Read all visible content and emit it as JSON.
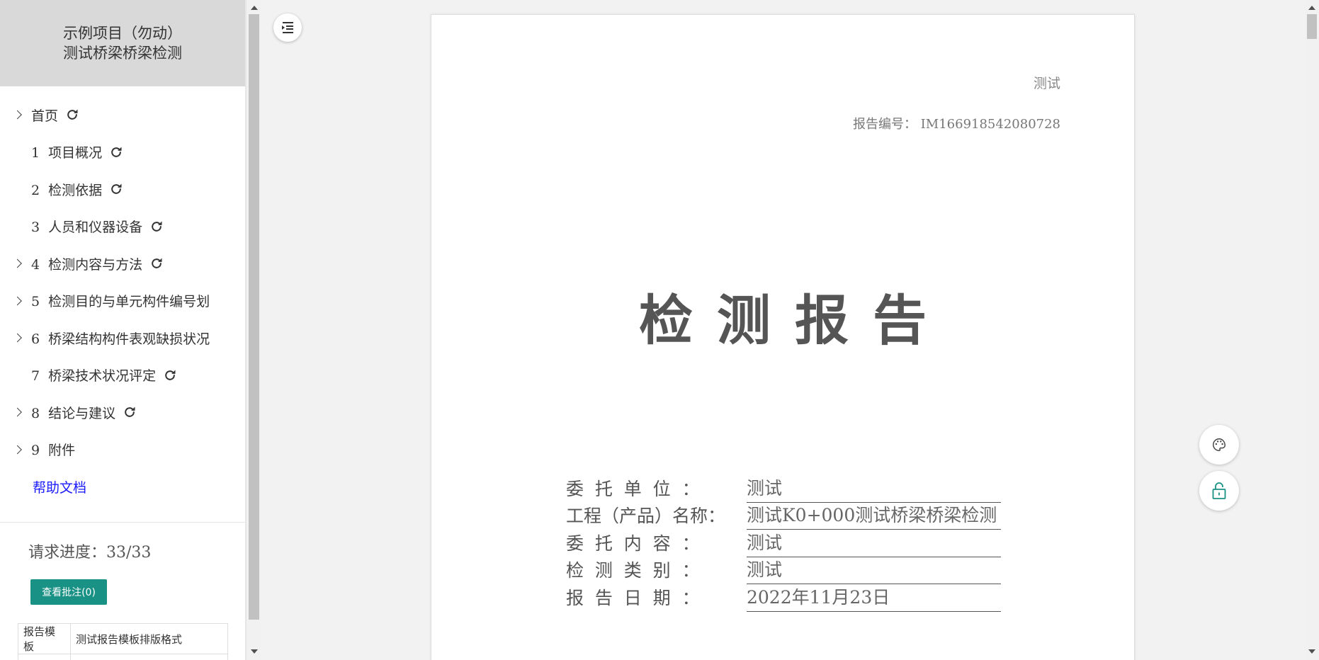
{
  "sidebar": {
    "title_line1": "示例项目（勿动）",
    "title_line2": "测试桥梁桥梁检测",
    "items": [
      {
        "label": "首页",
        "expandable": true,
        "refresh": true
      },
      {
        "label": "1  项目概况",
        "expandable": false,
        "refresh": true
      },
      {
        "label": "2  检测依据",
        "expandable": false,
        "refresh": true
      },
      {
        "label": "3  人员和仪器设备",
        "expandable": false,
        "refresh": true
      },
      {
        "label": "4  检测内容与方法",
        "expandable": true,
        "refresh": true
      },
      {
        "label": "5  检测目的与单元构件编号划",
        "expandable": true,
        "refresh": false
      },
      {
        "label": "6  桥梁结构构件表观缺损状况",
        "expandable": true,
        "refresh": false
      },
      {
        "label": "7  桥梁技术状况评定",
        "expandable": false,
        "refresh": true
      },
      {
        "label": "8  结论与建议",
        "expandable": true,
        "refresh": true
      },
      {
        "label": "9  附件",
        "expandable": true,
        "refresh": false
      }
    ],
    "help_label": "帮助文档",
    "progress_label": "请求进度：33/33",
    "annotation_button": "查看批注(0)",
    "template_label": "报告模板",
    "template_value": "测试报告模板排版格式"
  },
  "document": {
    "org": "测试",
    "report_number": "报告编号： IM166918542080728",
    "title": "检测报告",
    "fields": [
      {
        "label": "委  托  单  位  ：",
        "value": "测试"
      },
      {
        "label": "工程（产品）名称：",
        "value": "测试K0+000测试桥梁桥梁检测"
      },
      {
        "label": "委  托  内  容  ：",
        "value": "测试"
      },
      {
        "label": "检  测  类  别  ：",
        "value": "测试"
      },
      {
        "label": "报  告  日  期  ：",
        "value": "2022年11月23日"
      }
    ]
  },
  "colors": {
    "accent": "#1a9185",
    "link": "#1a1aff",
    "sidebar_header": "#d9d9d9",
    "lock_icon": "#1a9185"
  },
  "icons": {
    "toc": "outline-list-icon",
    "theme": "palette-icon",
    "lock": "lock-icon",
    "refresh": "refresh-icon"
  }
}
